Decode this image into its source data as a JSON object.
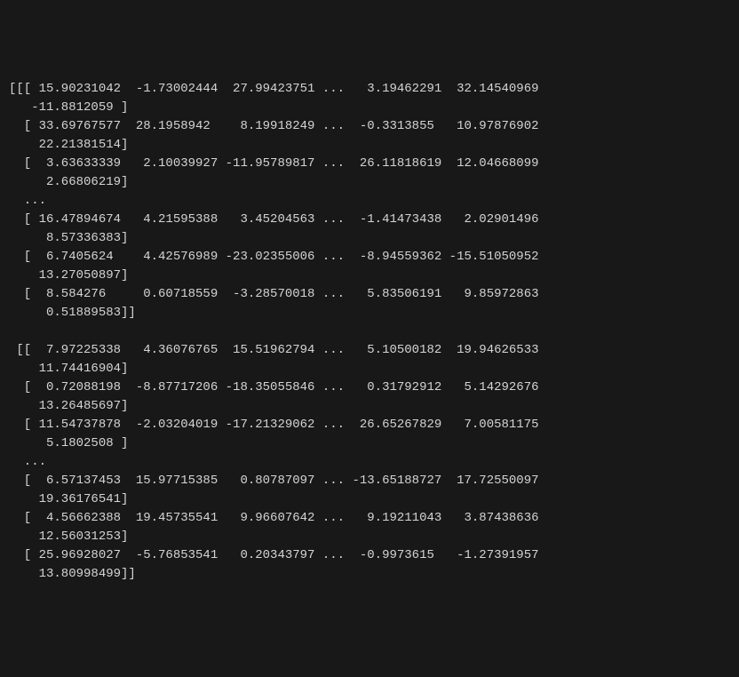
{
  "output": {
    "lines": [
      "[[[ 15.90231042  -1.73002444  27.99423751 ...   3.19462291  32.14540969",
      "   -11.8812059 ]",
      "  [ 33.69767577  28.1958942    8.19918249 ...  -0.3313855   10.97876902",
      "    22.21381514]",
      "  [  3.63633339   2.10039927 -11.95789817 ...  26.11818619  12.04668099",
      "     2.66806219]",
      "  ...",
      "  [ 16.47894674   4.21595388   3.45204563 ...  -1.41473438   2.02901496",
      "     8.57336383]",
      "  [  6.7405624    4.42576989 -23.02355006 ...  -8.94559362 -15.51050952",
      "    13.27050897]",
      "  [  8.584276     0.60718559  -3.28570018 ...   5.83506191   9.85972863",
      "     0.51889583]]",
      "",
      " [[  7.97225338   4.36076765  15.51962794 ...   5.10500182  19.94626533",
      "    11.74416904]",
      "  [  0.72088198  -8.87717206 -18.35055846 ...   0.31792912   5.14292676",
      "    13.26485697]",
      "  [ 11.54737878  -2.03204019 -17.21329062 ...  26.65267829   7.00581175",
      "     5.1802508 ]",
      "  ...",
      "  [  6.57137453  15.97715385   0.80787097 ... -13.65188727  17.72550097",
      "    19.36176541]",
      "  [  4.56662388  19.45735541   9.96607642 ...   9.19211043   3.87438636",
      "    12.56031253]",
      "  [ 25.96928027  -5.76853541   0.20343797 ...  -0.9973615   -1.27391957",
      "    13.80998499]]"
    ]
  }
}
